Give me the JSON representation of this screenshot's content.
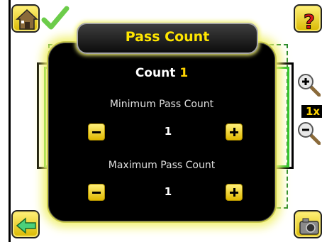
{
  "dialog": {
    "title": "Pass Count",
    "count_label": "Count",
    "count_value": "1",
    "minimum": {
      "label": "Minimum Pass Count",
      "value": "1"
    },
    "maximum": {
      "label": "Maximum Pass Count",
      "value": "1"
    }
  },
  "zoom": {
    "level_label": "1x"
  },
  "icons": {
    "home": "home-icon",
    "check": "checkmark-icon",
    "help": "question-mark-icon",
    "zoom_in": "zoom-in-icon",
    "zoom_out": "zoom-out-icon",
    "back": "back-arrow-icon",
    "camera": "camera-icon"
  },
  "colors": {
    "accent_yellow": "#ffd400",
    "roi_green": "#2a8a2a",
    "dialog_glow": "#f1f170"
  }
}
